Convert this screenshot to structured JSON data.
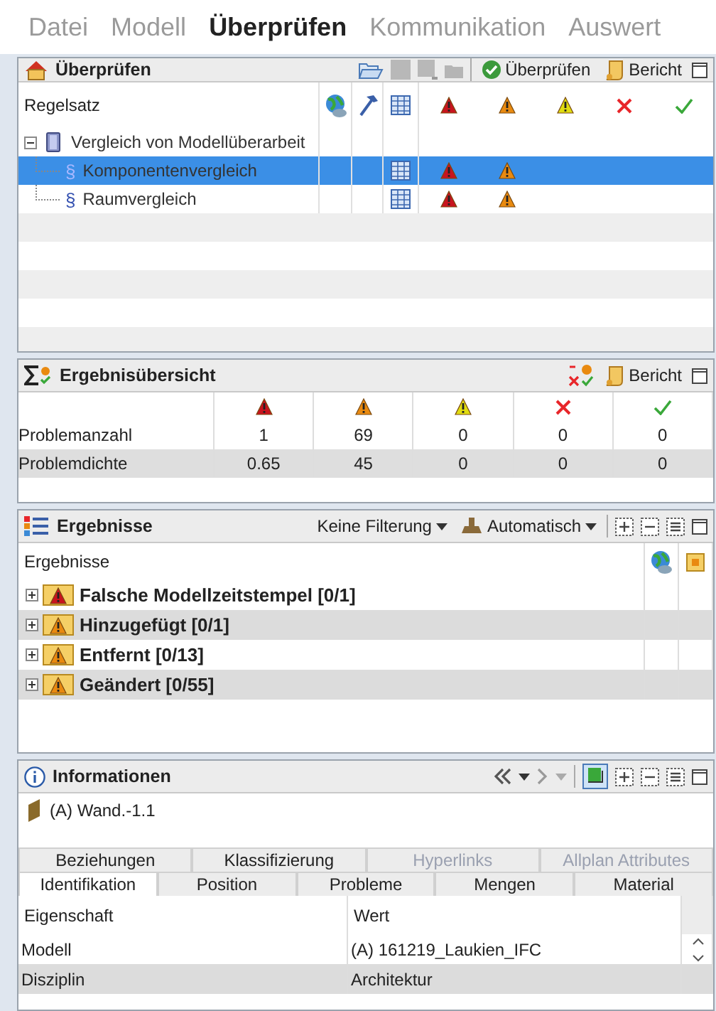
{
  "menu": [
    {
      "label": "Datei",
      "selected": false
    },
    {
      "label": "Modell",
      "selected": false
    },
    {
      "label": "Überprüfen",
      "selected": true
    },
    {
      "label": "Kommunikation",
      "selected": false
    },
    {
      "label": "Auswert",
      "selected": false
    }
  ],
  "check_panel": {
    "title": "Überprüfen",
    "buttons": [
      {
        "kind": "check",
        "label": "Überprüfen"
      },
      {
        "kind": "report",
        "label": "Bericht"
      }
    ],
    "column_header": "Regelsatz",
    "rules": [
      {
        "label": "Vergleich von Modellüberarbeit",
        "expanded": true,
        "selected": false,
        "kind": "ruleset",
        "table": false,
        "has_error": false,
        "has_warning": false,
        "children": [
          {
            "label": "Komponentenvergleich",
            "section": "§",
            "selected": true,
            "kind": "rule",
            "table": true,
            "has_error": true,
            "has_warning": true
          },
          {
            "label": "Raumvergleich",
            "section": "§",
            "selected": false,
            "kind": "rule",
            "table": true,
            "has_error": true,
            "has_warning": true
          }
        ]
      }
    ]
  },
  "summary_panel": {
    "title": "Ergebnisübersicht",
    "button": "Bericht",
    "rows": [
      {
        "label": "Problemanzahl",
        "values": [
          "1",
          "69",
          "0",
          "0",
          "0"
        ]
      },
      {
        "label": "Problemdichte",
        "values": [
          "0.65",
          "45",
          "0",
          "0",
          "0"
        ]
      }
    ]
  },
  "results_panel": {
    "title": "Ergebnisse",
    "filter": "Keine Filterung",
    "mode": "Automatisch",
    "column_header": "Ergebnisse",
    "results": [
      {
        "label": "Falsche Modellzeitstempel [0/1]",
        "kind": "error",
        "expanded": false
      },
      {
        "label": "Hinzugefügt [0/1]",
        "kind": "warning",
        "expanded": false
      },
      {
        "label": "Entfernt [0/13]",
        "kind": "warning",
        "expanded": false
      },
      {
        "label": "Geändert [0/55]",
        "kind": "warning",
        "expanded": false
      }
    ]
  },
  "info_panel": {
    "title": "Informationen",
    "object": "(A) Wand.-1.1",
    "tabs_back": [
      {
        "label": "Beziehungen",
        "disabled": false
      },
      {
        "label": "Klassifizierung",
        "disabled": false
      },
      {
        "label": "Hyperlinks",
        "disabled": true
      },
      {
        "label": "Allplan Attributes",
        "disabled": true
      }
    ],
    "tabs_front": [
      {
        "label": "Identifikation",
        "selected": true
      },
      {
        "label": "Position",
        "selected": false
      },
      {
        "label": "Probleme",
        "selected": false
      },
      {
        "label": "Mengen",
        "selected": false
      },
      {
        "label": "Material",
        "selected": false
      }
    ],
    "columns": [
      "Eigenschaft",
      "Wert"
    ],
    "rows": [
      {
        "property": "Modell",
        "value": "(A) 161219_Laukien_IFC"
      },
      {
        "property": "Disziplin",
        "value": "Architektur"
      }
    ]
  }
}
